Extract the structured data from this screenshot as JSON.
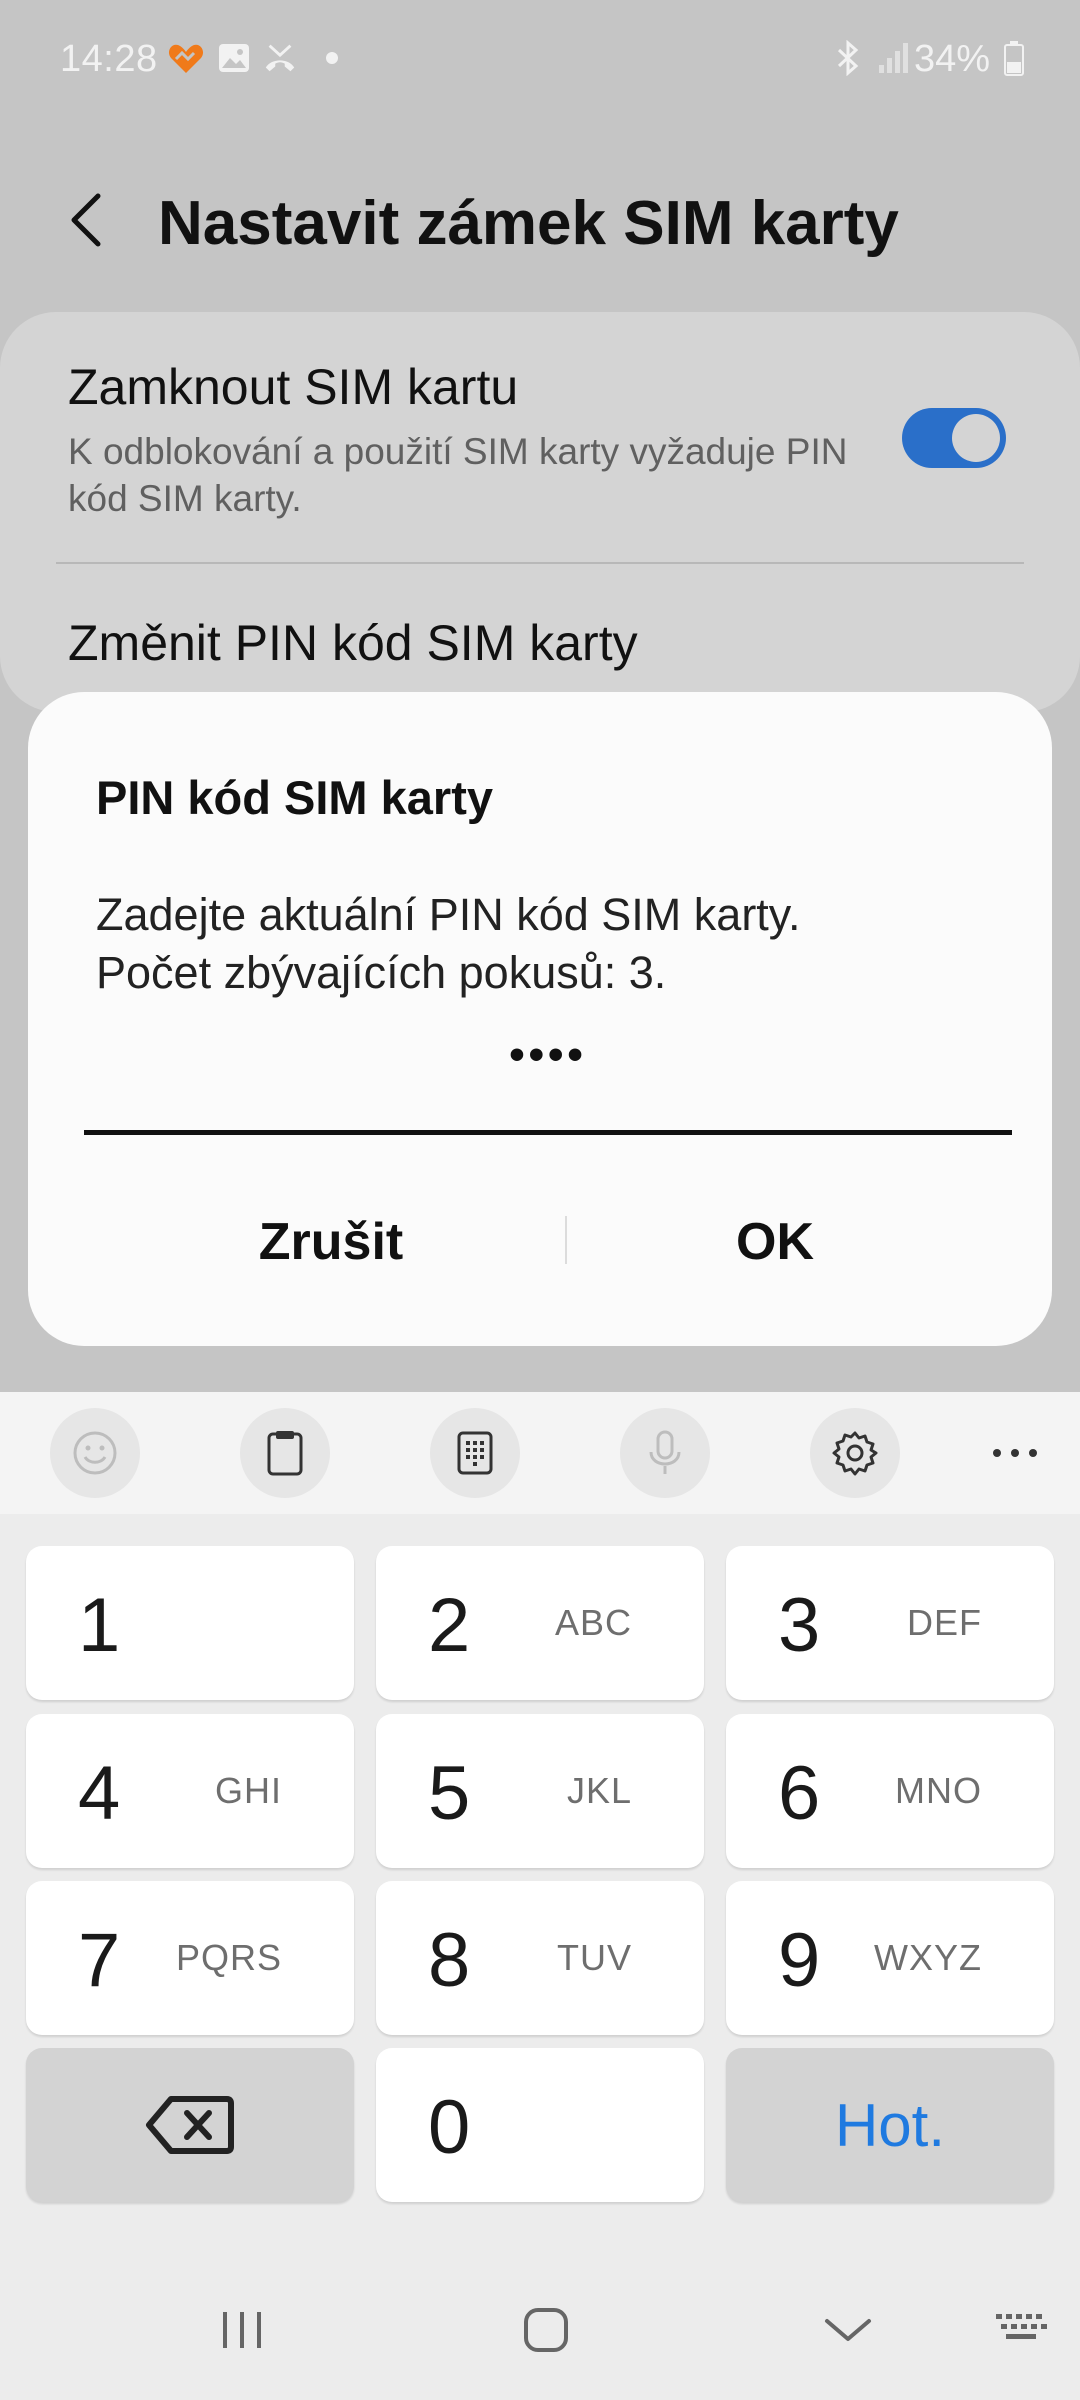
{
  "status_bar": {
    "time": "14:28",
    "battery": "34%",
    "left_icons": [
      "heart-sync-icon",
      "gallery-icon",
      "missed-call-icon",
      "notification-dot-icon"
    ],
    "right_icons": [
      "bluetooth-icon",
      "signal-icon",
      "battery-icon"
    ]
  },
  "header": {
    "title": "Nastavit zámek SIM karty",
    "back_icon": "chevron-left-icon"
  },
  "settings": {
    "lock_sim_title": "Zamknout SIM kartu",
    "lock_sim_description": "K odblokování a použití SIM karty vyžaduje PIN kód SIM karty.",
    "lock_sim_enabled": true,
    "change_pin_title": "Změnit PIN kód SIM karty"
  },
  "dialog": {
    "title": "PIN kód SIM karty",
    "message_line1": "Zadejte aktuální PIN kód SIM karty.",
    "message_line2": "Počet zbývajících pokusů: 3.",
    "pin_value": "••••",
    "cancel_label": "Zrušit",
    "ok_label": "OK"
  },
  "keyboard_toolbar": [
    "emoji-icon",
    "clipboard-icon",
    "keypad-icon",
    "microphone-icon",
    "settings-gear-icon",
    "more-icon"
  ],
  "keyboard": {
    "keys": [
      {
        "num": "1",
        "letters": ""
      },
      {
        "num": "2",
        "letters": "ABC"
      },
      {
        "num": "3",
        "letters": "DEF"
      },
      {
        "num": "4",
        "letters": "GHI"
      },
      {
        "num": "5",
        "letters": "JKL"
      },
      {
        "num": "6",
        "letters": "MNO"
      },
      {
        "num": "7",
        "letters": "PQRS"
      },
      {
        "num": "8",
        "letters": "TUV"
      },
      {
        "num": "9",
        "letters": "WXYZ"
      },
      {
        "num": "0",
        "letters": ""
      }
    ],
    "done_label": "Hot.",
    "accent_color": "#1f7ae0"
  },
  "nav_bar": [
    "recent-apps-icon",
    "home-icon",
    "hide-keyboard-icon",
    "keyboard-switch-icon"
  ]
}
